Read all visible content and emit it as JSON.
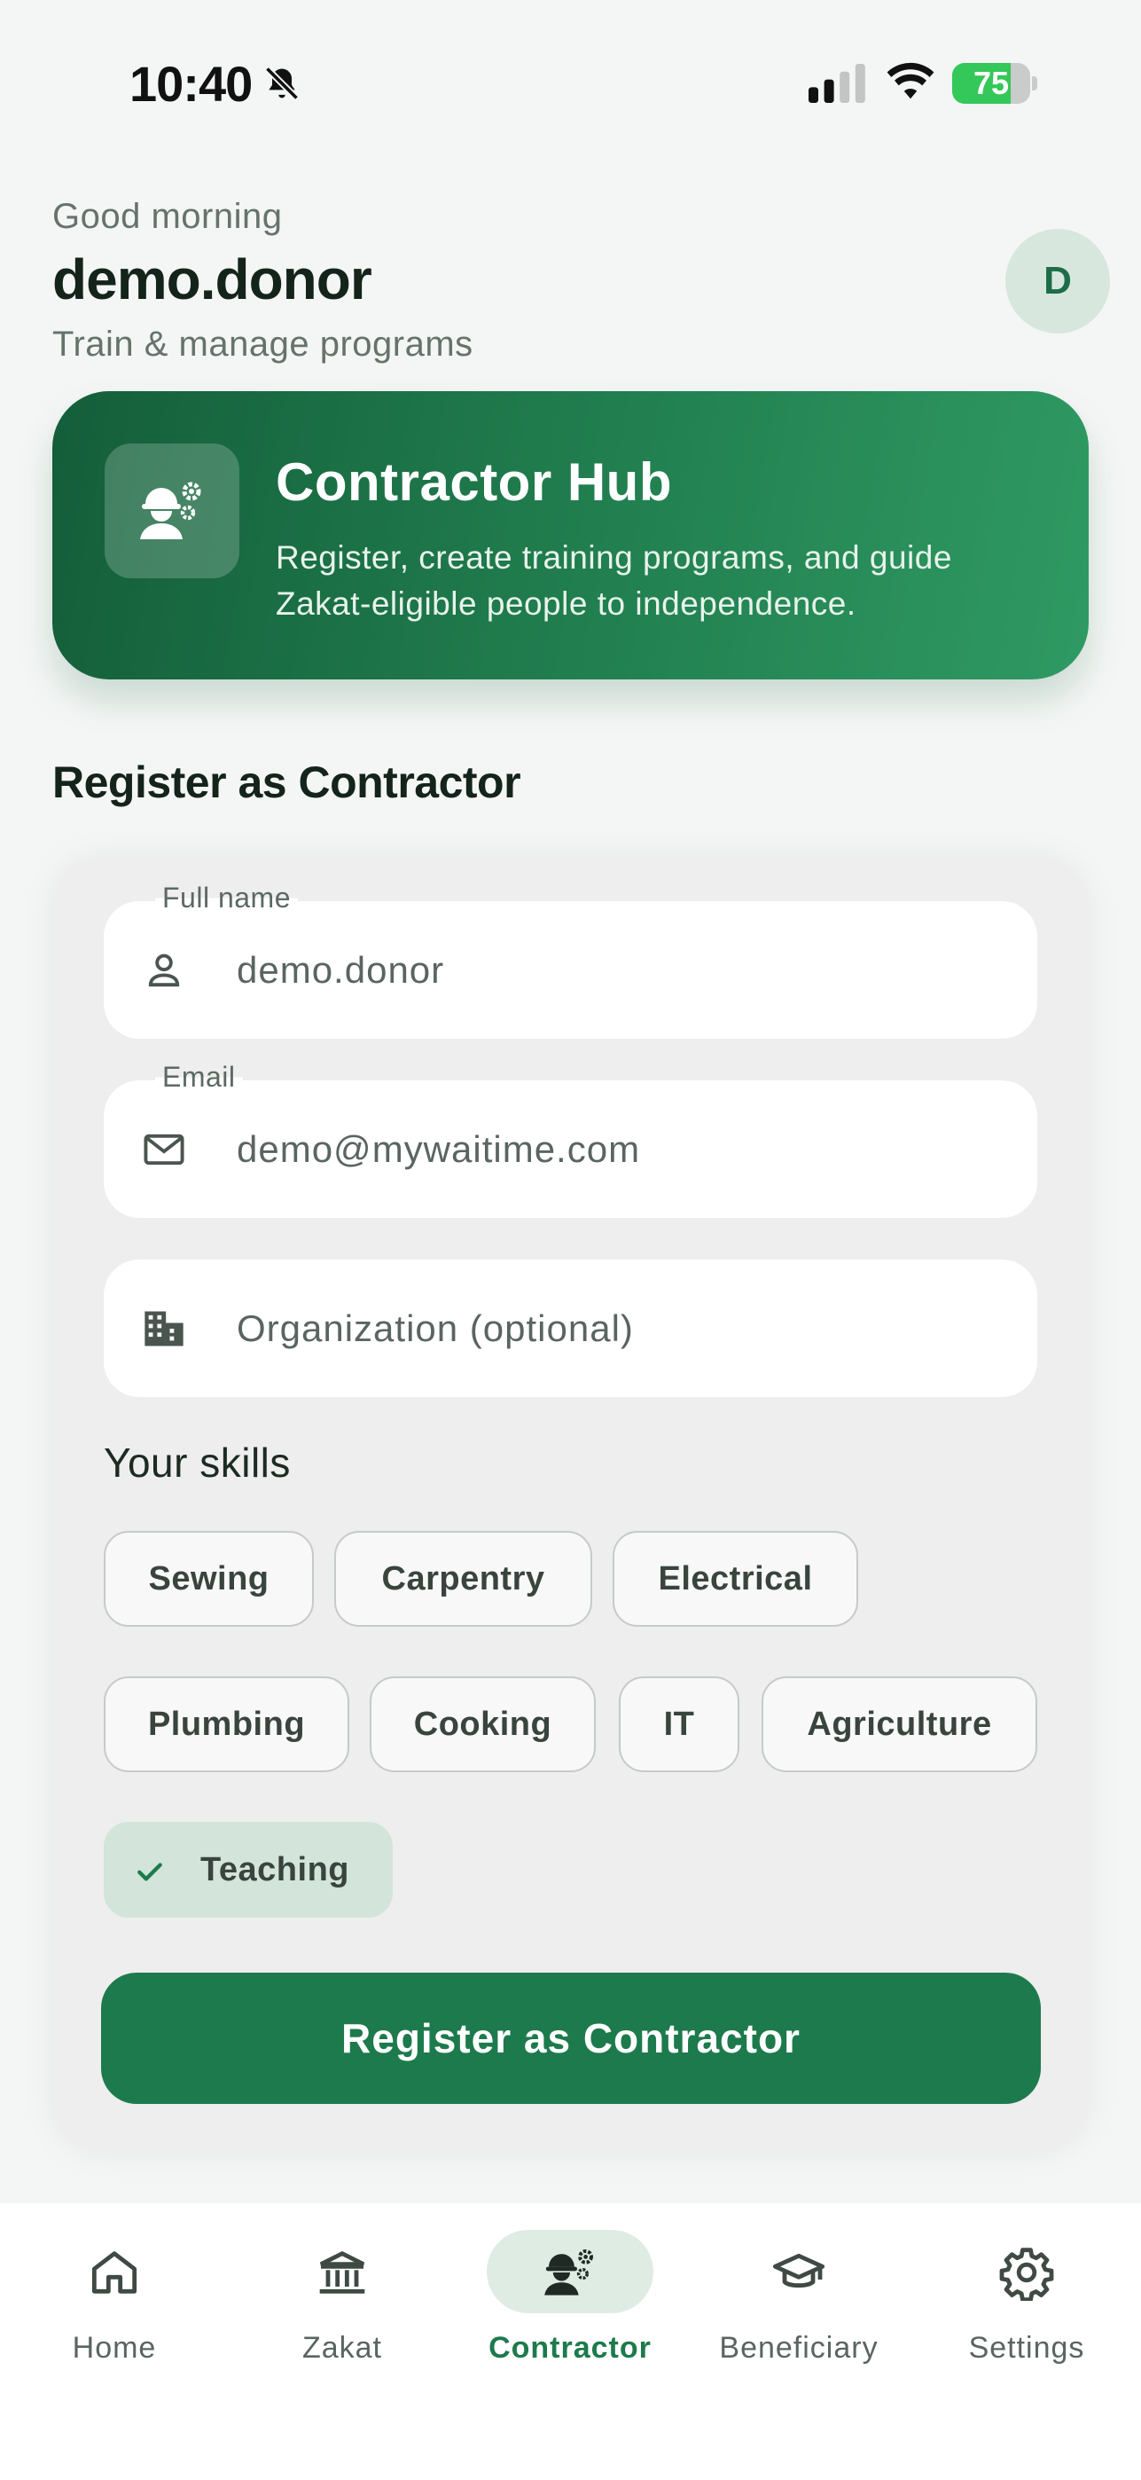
{
  "status_bar": {
    "time": "10:40",
    "battery_percent": "75",
    "battery_level": 0.75
  },
  "header": {
    "greeting": "Good morning",
    "username": "demo.donor",
    "subtitle": "Train & manage programs",
    "avatar_initial": "D"
  },
  "hero": {
    "title": "Contractor Hub",
    "description": "Register, create training programs, and guide Zakat-eligible people to independence.",
    "icon": "contractor-gears-icon"
  },
  "section_title": "Register as Contractor",
  "form": {
    "full_name": {
      "label": "Full name",
      "value": "demo.donor",
      "icon": "person-icon"
    },
    "email": {
      "label": "Email",
      "value": "demo@mywaitime.com",
      "icon": "mail-icon"
    },
    "organization": {
      "placeholder": "Organization (optional)",
      "icon": "building-icon"
    },
    "skills_title": "Your skills",
    "skills": [
      {
        "label": "Sewing",
        "selected": false
      },
      {
        "label": "Carpentry",
        "selected": false
      },
      {
        "label": "Electrical",
        "selected": false
      },
      {
        "label": "Plumbing",
        "selected": false
      },
      {
        "label": "Cooking",
        "selected": false
      },
      {
        "label": "IT",
        "selected": false
      },
      {
        "label": "Agriculture",
        "selected": false
      },
      {
        "label": "Teaching",
        "selected": true
      }
    ],
    "submit_label": "Register as Contractor"
  },
  "nav": [
    {
      "label": "Home",
      "icon": "home-icon",
      "active": false
    },
    {
      "label": "Zakat",
      "icon": "bank-icon",
      "active": false
    },
    {
      "label": "Contractor",
      "icon": "contractor-icon",
      "active": true
    },
    {
      "label": "Beneficiary",
      "icon": "graduation-cap-icon",
      "active": false
    },
    {
      "label": "Settings",
      "icon": "gear-icon",
      "active": false
    }
  ],
  "colors": {
    "primary": "#1d7a4c",
    "hero_start": "#145e3a",
    "hero_end": "#2f9a63",
    "background": "#f4f6f5",
    "chip_selected": "#d3e4da"
  }
}
